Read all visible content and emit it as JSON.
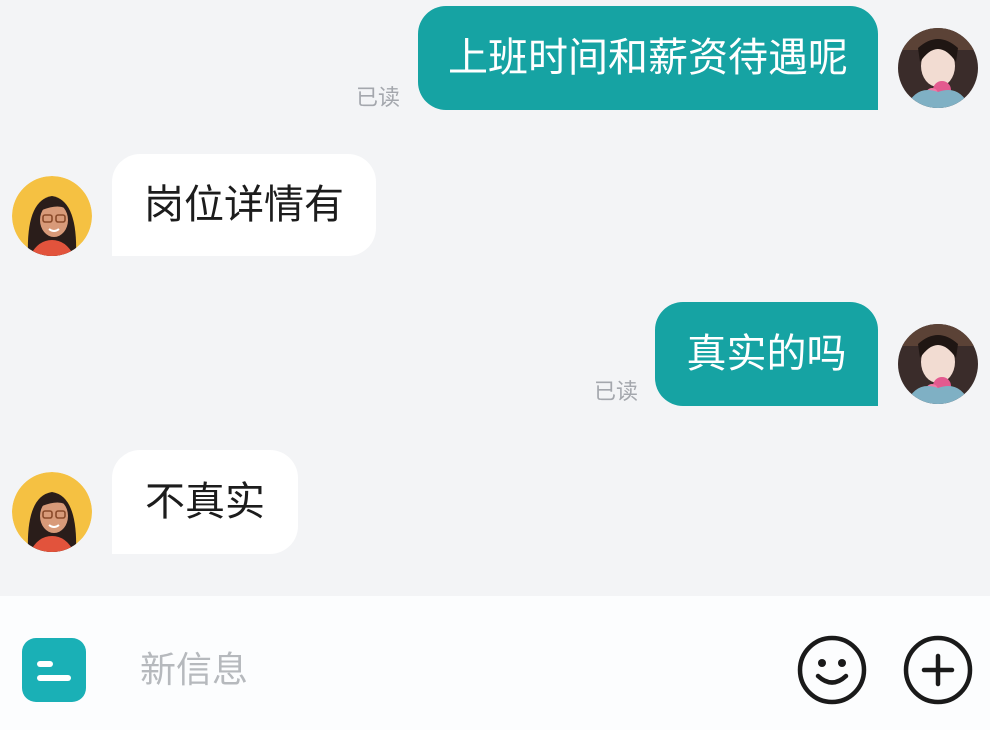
{
  "messages": [
    {
      "direction": "outgoing",
      "text": "上班时间和薪资待遇呢",
      "status": "已读"
    },
    {
      "direction": "incoming",
      "text": "岗位详情有"
    },
    {
      "direction": "outgoing",
      "text": "真实的吗",
      "status": "已读"
    },
    {
      "direction": "incoming",
      "text": "不真实"
    }
  ],
  "composer": {
    "placeholder": "新信息"
  },
  "icons": {
    "menu": "menu-icon",
    "emoji": "smiley-icon",
    "add": "plus-circle-icon"
  },
  "colors": {
    "outgoing_bubble": "#16a3a3",
    "incoming_bubble": "#ffffff",
    "menu_button": "#1ab0b6",
    "background": "#f3f4f6"
  }
}
